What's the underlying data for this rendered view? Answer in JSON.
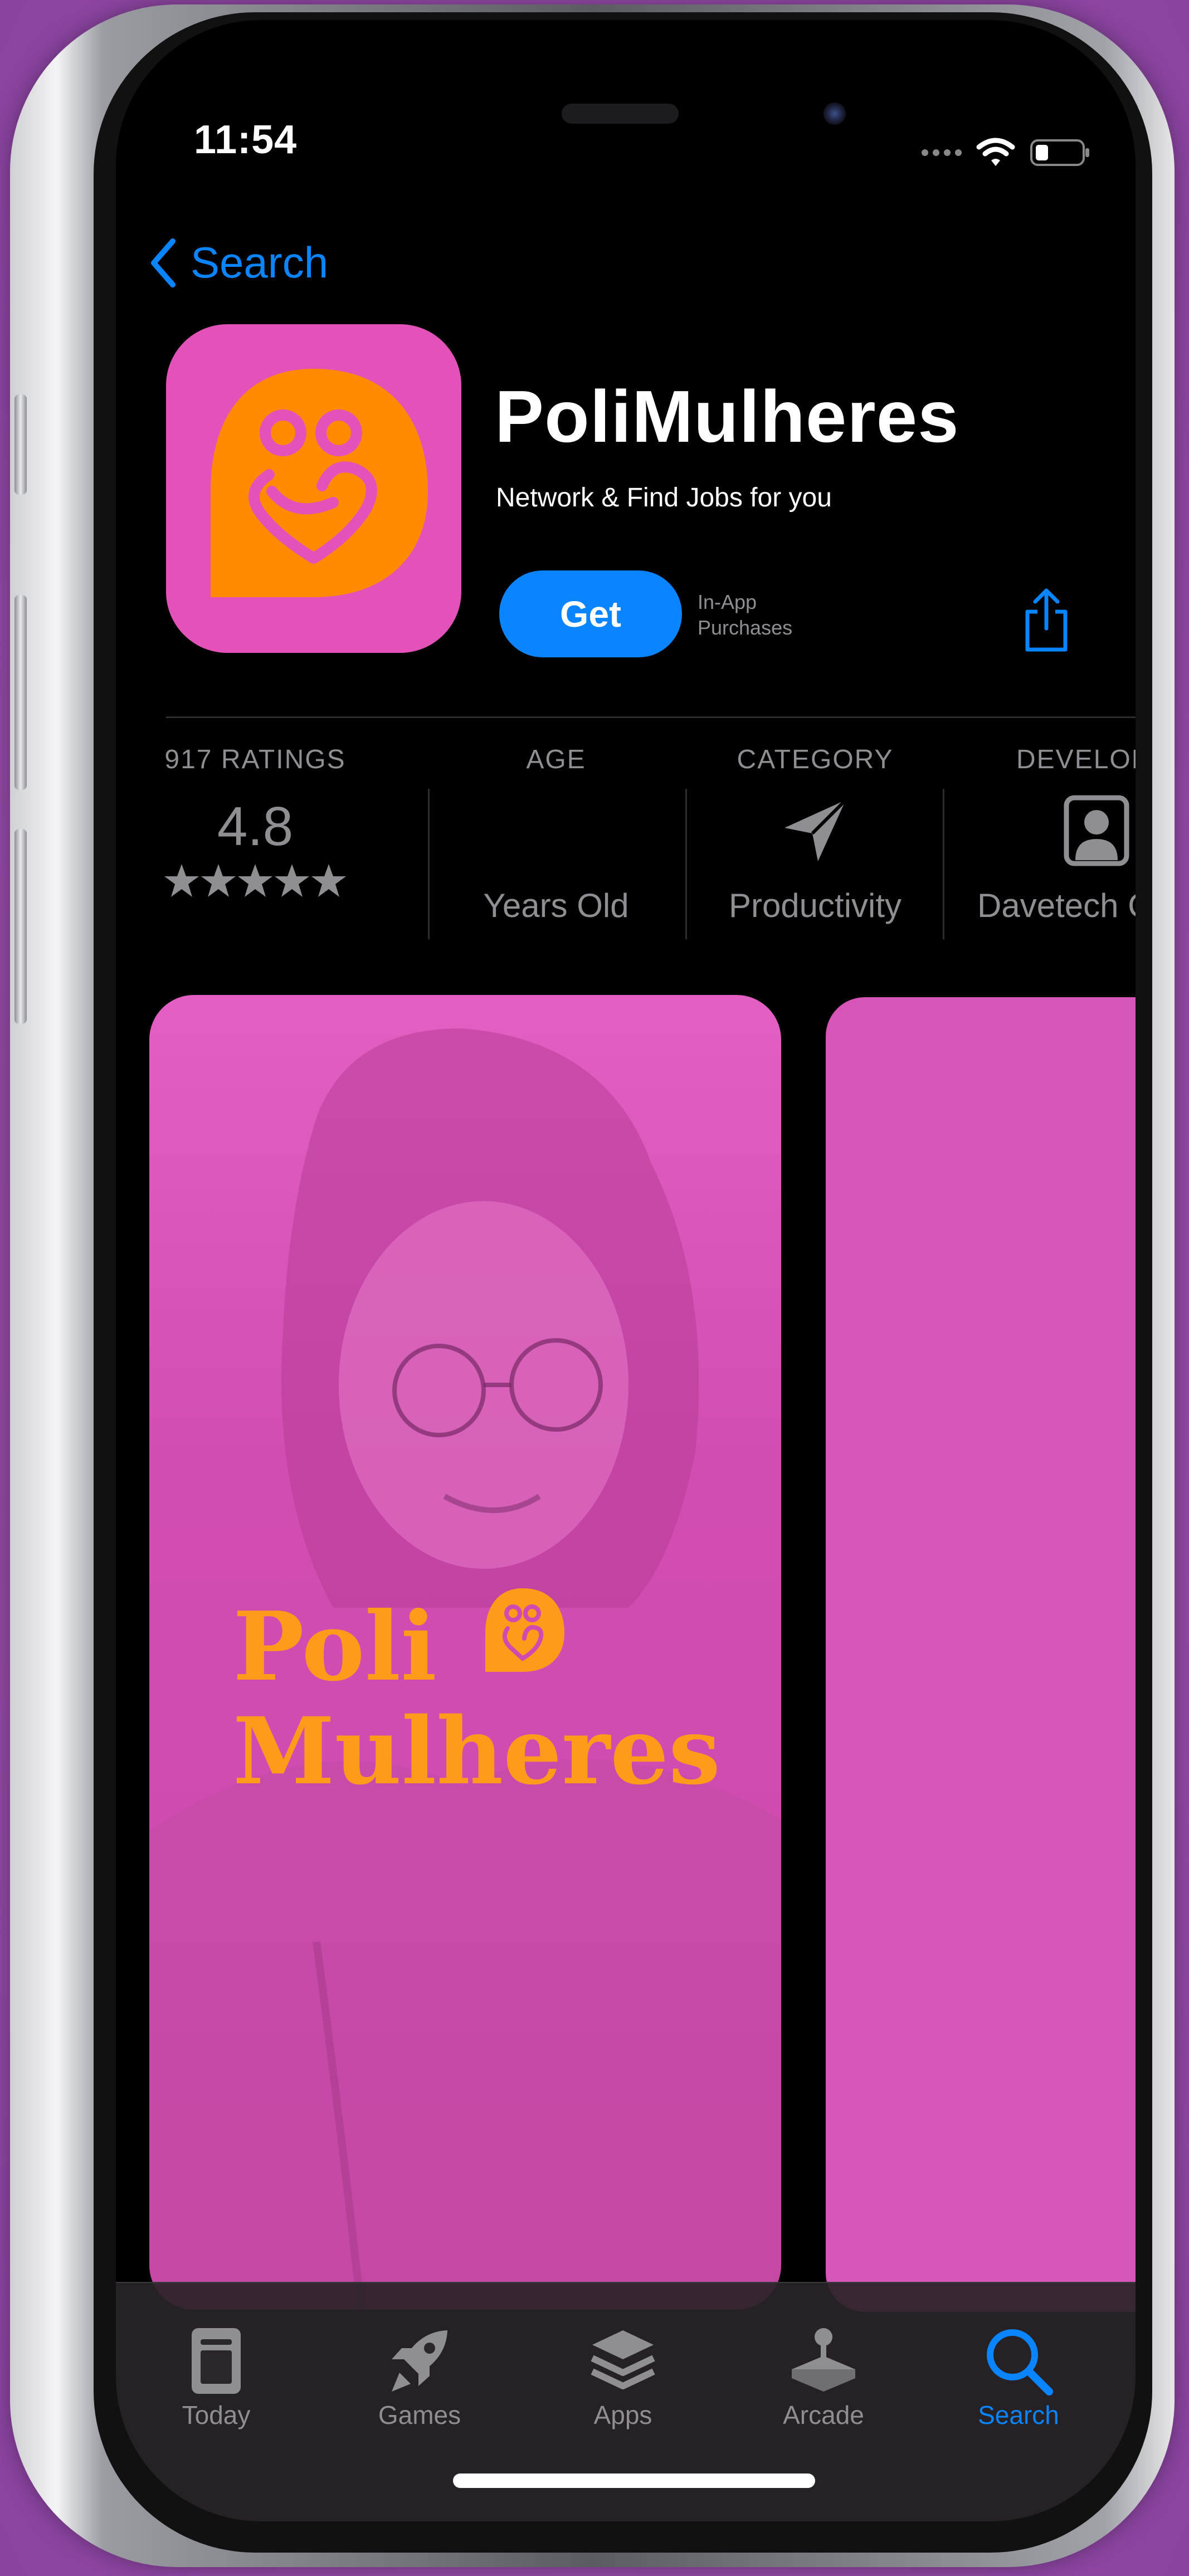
{
  "colors": {
    "accent": "#0a84ff",
    "brand_pink": "#e352b8",
    "brand_orange": "#ff9b1a"
  },
  "status_bar": {
    "time": "11:54"
  },
  "nav": {
    "back_label": "Search"
  },
  "app": {
    "name": "PoliMulheres",
    "subtitle": "Network & Find Jobs for you",
    "get_label": "Get",
    "in_app_line1": "In-App",
    "in_app_line2": "Purchases"
  },
  "info": {
    "ratings": {
      "label": "917 RATINGS",
      "value": "4.8",
      "stars": 5
    },
    "age": {
      "label": "AGE",
      "sub": "Years Old"
    },
    "category": {
      "label": "CATEGORY",
      "sub": "Productivity",
      "icon": "paper-plane-icon"
    },
    "developer": {
      "label": "DEVELOP",
      "sub": "Davetech C",
      "icon": "person-icon"
    }
  },
  "screenshot": {
    "line1": "Poli",
    "line2": "Mulheres"
  },
  "tabs": [
    {
      "label": "Today",
      "icon": "today-icon"
    },
    {
      "label": "Games",
      "icon": "rocket-icon"
    },
    {
      "label": "Apps",
      "icon": "layers-icon"
    },
    {
      "label": "Arcade",
      "icon": "joystick-icon"
    },
    {
      "label": "Search",
      "icon": "search-icon",
      "active": true
    }
  ]
}
